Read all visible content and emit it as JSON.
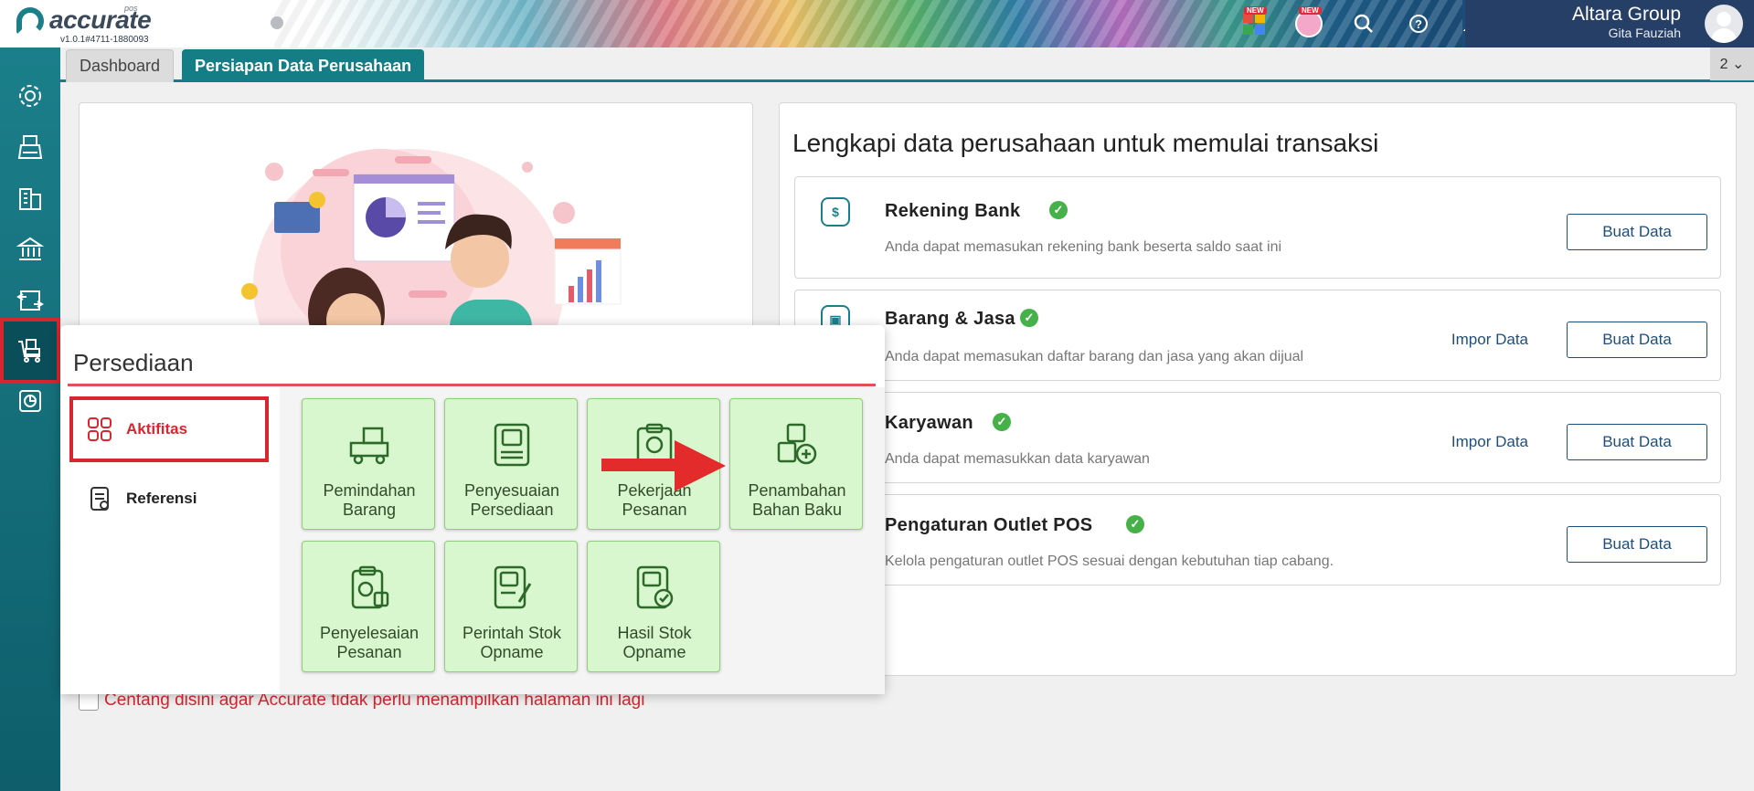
{
  "app": {
    "logo_name": "accurate",
    "logo_sub": "pos",
    "version": "v1.0.1#4711-1880093"
  },
  "topbar": {
    "badges": [
      "NEW",
      "NEW"
    ],
    "company": "Altara Group",
    "user": "Gita Fauziah"
  },
  "tabs": {
    "items": [
      "Dashboard",
      "Persiapan Data Perusahaan"
    ],
    "count": "2 ⌄"
  },
  "setup": {
    "title": "Lengkapi data perusahaan untuk memulai transaksi",
    "rows": [
      {
        "title": "Rekening Bank",
        "desc": "Anda dapat memasukan rekening bank beserta saldo saat ini",
        "import": "",
        "create": "Buat Data"
      },
      {
        "title": "Barang & Jasa",
        "desc": "Anda dapat memasukan daftar barang dan jasa yang akan dijual",
        "import": "Impor Data",
        "create": "Buat Data"
      },
      {
        "title": "Karyawan",
        "desc": "Anda dapat memasukkan data karyawan",
        "import": "Impor Data",
        "create": "Buat Data"
      },
      {
        "title": "Pengaturan Outlet POS",
        "desc": "Kelola pengaturan outlet POS sesuai dengan kebutuhan tiap cabang.",
        "import": "",
        "create": "Buat Data"
      }
    ]
  },
  "dont_show": "Centang disini agar Accurate tidak perlu menampilkan halaman ini lagi",
  "popup": {
    "title": "Persediaan",
    "nav": [
      "Aktifitas",
      "Referensi"
    ],
    "tiles": [
      "Pemindahan Barang",
      "Penyesuaian Persediaan",
      "Pekerjaan Pesanan",
      "Penambahan Bahan Baku",
      "Penyelesaian Pesanan",
      "Perintah Stok Opname",
      "Hasil Stok Opname"
    ]
  },
  "colors": {
    "teal": "#147d86",
    "accent_red": "#d7262e",
    "tile_bg": "#d9f7cf",
    "check_green": "#46b148",
    "link_blue": "#1f4e7a"
  },
  "icons": {
    "rail": [
      "gear-icon",
      "pos-register-icon",
      "building-icon",
      "bank-icon",
      "money-transfer-icon",
      "inventory-cart-icon",
      "report-icon"
    ]
  }
}
